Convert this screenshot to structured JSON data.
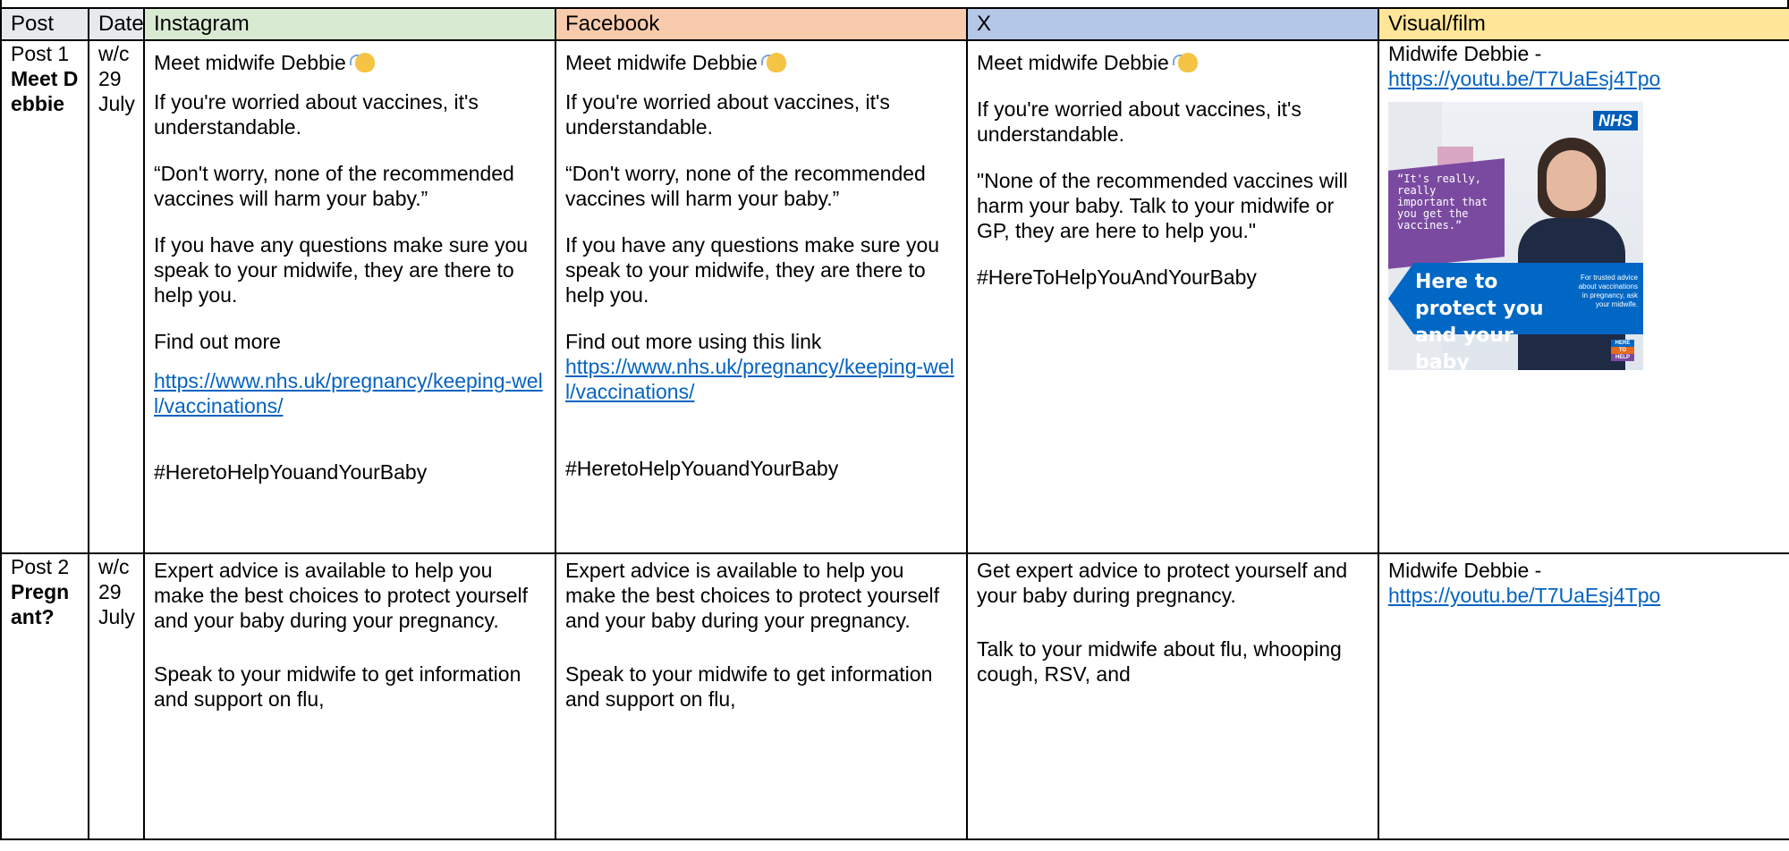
{
  "table": {
    "headers": {
      "post": "Post",
      "date": "Date",
      "instagram": "Instagram",
      "facebook": "Facebook",
      "x": "X",
      "visual": "Visual/film"
    },
    "rows": [
      {
        "post_num": "Post 1",
        "post_title": "Meet Debbie",
        "date": "w/c 29 July",
        "instagram": {
          "l1": "Meet midwife Debbie",
          "l2": "If you're worried about vaccines, it's understandable.",
          "l3": "“Don't worry, none of the recommended vaccines will harm your baby.”",
          "l4": "If you have any questions make sure you speak to your midwife, they are there to help you.",
          "l5": "Find out more",
          "link": "https://www.nhs.uk/pregnancy/keeping-well/vaccinations/",
          "tag": "#HeretoHelpYouandYourBaby"
        },
        "facebook": {
          "l1": "Meet midwife Debbie",
          "l2": "If you're worried about vaccines, it's understandable.",
          "l3": "“Don't worry, none of the recommended vaccines will harm your baby.”",
          "l4": "If you have any questions make sure you speak to your midwife, they are there to help you.",
          "l5": "Find out more using this link",
          "link": "https://www.nhs.uk/pregnancy/keeping-well/vaccinations/",
          "tag": "#HeretoHelpYouandYourBaby"
        },
        "x": {
          "l1": "Meet midwife Debbie",
          "l2": "If you're worried about vaccines, it's understandable.",
          "l3": "\"None of the recommended vaccines will harm your baby. Talk to your midwife or GP, they are here to help you.\"",
          "tag": "#HereToHelpYouAndYourBaby"
        },
        "visual": {
          "label": "Midwife Debbie -",
          "link": "https://youtu.be/T7UaEsj4Tpo",
          "image": {
            "nhs": "NHS",
            "quote": "“It's really, really important that you get the vaccines.”",
            "headline": "Here to protect you and your baby",
            "note": "For trusted advice about vaccinations in pregnancy, ask your midwife.",
            "logo_1": "HERE",
            "logo_2": "TO",
            "logo_3": "HELP"
          }
        }
      },
      {
        "post_num": "Post 2",
        "post_title": "Pregnant?",
        "date": "w/c 29 July",
        "instagram": {
          "l1": "Expert advice is available to help you make the best choices to protect yourself and your baby during your pregnancy.",
          "l2": "Speak to your midwife to get information and support on flu,"
        },
        "facebook": {
          "l1": "Expert advice is available to help you make the best choices to protect yourself and your baby during your pregnancy.",
          "l2": "Speak to your midwife to get information and support on flu,"
        },
        "x": {
          "l1": "Get expert advice to protect yourself and your baby during pregnancy.",
          "l2": "Talk to your midwife about flu, whooping cough, RSV, and"
        },
        "visual": {
          "label": "Midwife Debbie -",
          "link": "https://youtu.be/T7UaEsj4Tpo"
        }
      }
    ]
  },
  "colors": {
    "instagram_header": "#d9ead3",
    "facebook_header": "#f8cbad",
    "x_header": "#b4c7e7",
    "visual_header": "#ffe699",
    "link": "#0563c1",
    "nhs_blue": "#005eb8"
  }
}
